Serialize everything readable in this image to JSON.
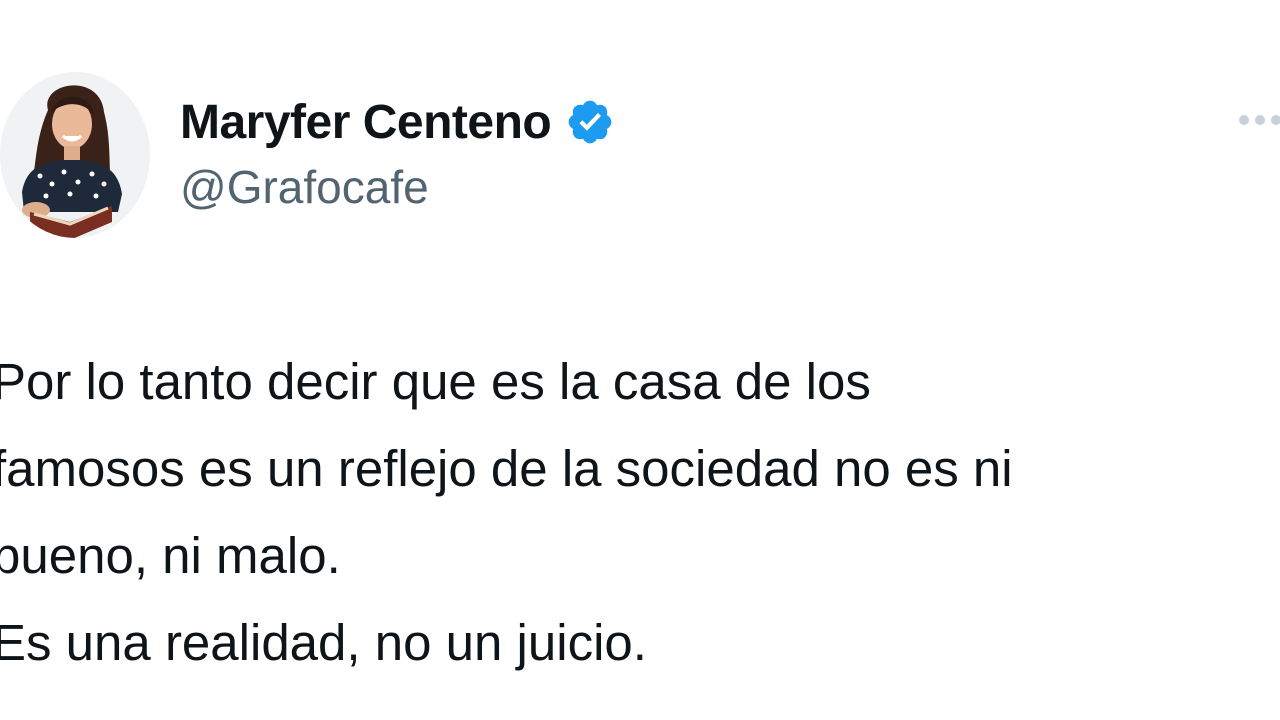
{
  "author": {
    "display_name": "Maryfer Centeno",
    "handle": "@Grafocafe",
    "verified": true,
    "verified_color": "#1d9bf0"
  },
  "avatar": {
    "icon": "profile-photo"
  },
  "more_menu": {
    "icon": "more-horizontal-icon"
  },
  "tweet": {
    "lines": [
      "Por lo tanto decir que es la casa de los",
      "famosos es un reflejo de la sociedad no es ni",
      "bueno, ni malo.",
      "Es una realidad, no un juicio."
    ]
  }
}
